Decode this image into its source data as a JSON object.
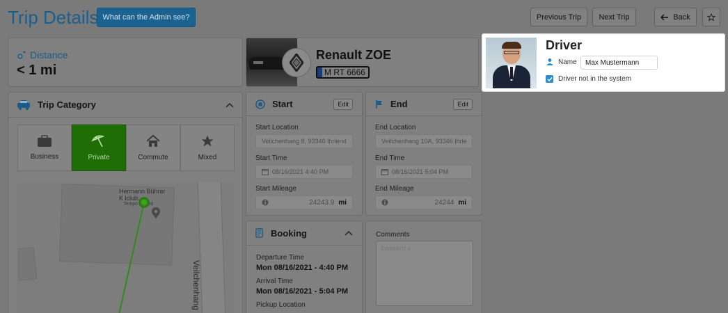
{
  "header": {
    "title": "Trip Details",
    "admin_button": "What can the Admin see?",
    "previous_trip": "Previous Trip",
    "next_trip": "Next Trip",
    "back": "Back"
  },
  "distance": {
    "label": "Distance",
    "value": "< 1 mi"
  },
  "vehicle": {
    "name": "Renault ZOE",
    "plate": "M RT 6666"
  },
  "driver": {
    "title": "Driver",
    "name_label": "Name",
    "name_value": "Max Mustermann",
    "not_in_system_label": "Driver not in the system",
    "not_in_system_checked": true
  },
  "trip_category": {
    "title": "Trip Category",
    "options": [
      {
        "label": "Business",
        "icon": "briefcase-icon",
        "active": false
      },
      {
        "label": "Private",
        "icon": "beach-umbrella-icon",
        "active": true
      },
      {
        "label": "Commute",
        "icon": "home-icon",
        "active": false
      },
      {
        "label": "Mixed",
        "icon": "star-icon",
        "active": false
      }
    ]
  },
  "map": {
    "poi_name_line1": "Hermann Bührer",
    "poi_name_line2": "K  lclub...",
    "poi_status": "Tempo     closed",
    "street": "Veilchenhang"
  },
  "start": {
    "title": "Start",
    "edit": "Edit",
    "location_label": "Start Location",
    "location_value": "Veilchenhang 8, 93346 Ihrlerst",
    "time_label": "Start Time",
    "time_value": "08/16/2021 4:40 PM",
    "mileage_label": "Start Mileage",
    "mileage_value": "24243.9",
    "mileage_unit": "mi"
  },
  "end": {
    "title": "End",
    "edit": "Edit",
    "location_label": "End Location",
    "location_value": "Veilchenhang 10A, 93346 Ihrle",
    "time_label": "End Time",
    "time_value": "08/16/2021 5:04 PM",
    "mileage_label": "End Mileage",
    "mileage_value": "24244",
    "mileage_unit": "mi"
  },
  "booking": {
    "title": "Booking",
    "departure_label": "Departure Time",
    "departure_value": "Mon 08/16/2021 - 4:40 PM",
    "arrival_label": "Arrival Time",
    "arrival_value": "Mon 08/16/2021 - 5:04 PM",
    "pickup_label": "Pickup Location"
  },
  "comments": {
    "label": "Comments",
    "placeholder": "Comments"
  },
  "colors": {
    "accent": "#2a8bcf",
    "private_active": "#2b9a07"
  }
}
